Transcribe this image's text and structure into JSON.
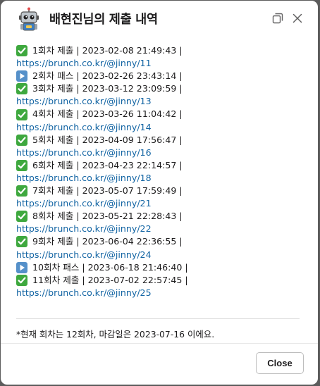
{
  "dialog": {
    "title": "배현진님의 제출 내역",
    "close_label": "Close"
  },
  "submissions": [
    {
      "status": "submit",
      "text": "1회차 제출 | 2023-02-08 21:49:43 |",
      "link": "https://brunch.co.kr/@jinny/11"
    },
    {
      "status": "pass",
      "text": "2회차 패스 | 2023-02-26 23:43:14 |",
      "link": ""
    },
    {
      "status": "submit",
      "text": "3회차 제출 | 2023-03-12 23:09:59 |",
      "link": "https://brunch.co.kr/@jinny/13"
    },
    {
      "status": "submit",
      "text": "4회차 제출 | 2023-03-26 11:04:42 |",
      "link": "https://brunch.co.kr/@jinny/14"
    },
    {
      "status": "submit",
      "text": "5회차 제출 | 2023-04-09 17:56:47 |",
      "link": "https://brunch.co.kr/@jinny/16"
    },
    {
      "status": "submit",
      "text": "6회차 제출 | 2023-04-23 22:14:57 |",
      "link": "https://brunch.co.kr/@jinny/18"
    },
    {
      "status": "submit",
      "text": "7회차 제출 | 2023-05-07 17:59:49 |",
      "link": "https://brunch.co.kr/@jinny/21"
    },
    {
      "status": "submit",
      "text": "8회차 제출 | 2023-05-21 22:28:43 |",
      "link": "https://brunch.co.kr/@jinny/22"
    },
    {
      "status": "submit",
      "text": "9회차 제출 | 2023-06-04 22:36:55 |",
      "link": "https://brunch.co.kr/@jinny/24"
    },
    {
      "status": "pass",
      "text": "10회차 패스 | 2023-06-18 21:46:40 |",
      "link": ""
    },
    {
      "status": "submit",
      "text": "11회차 제출 | 2023-07-02 22:57:45 |",
      "link": "https://brunch.co.kr/@jinny/25"
    }
  ],
  "footnote": "*현재 회차는 12회차, 마감일은 2023-07-16 이에요.",
  "icons": {
    "submit": "check-mark-button-icon",
    "pass": "play-button-icon"
  },
  "colors": {
    "link": "#1264a3",
    "submit_emoji": "#3ea83e",
    "pass_emoji": "#5590c9"
  }
}
